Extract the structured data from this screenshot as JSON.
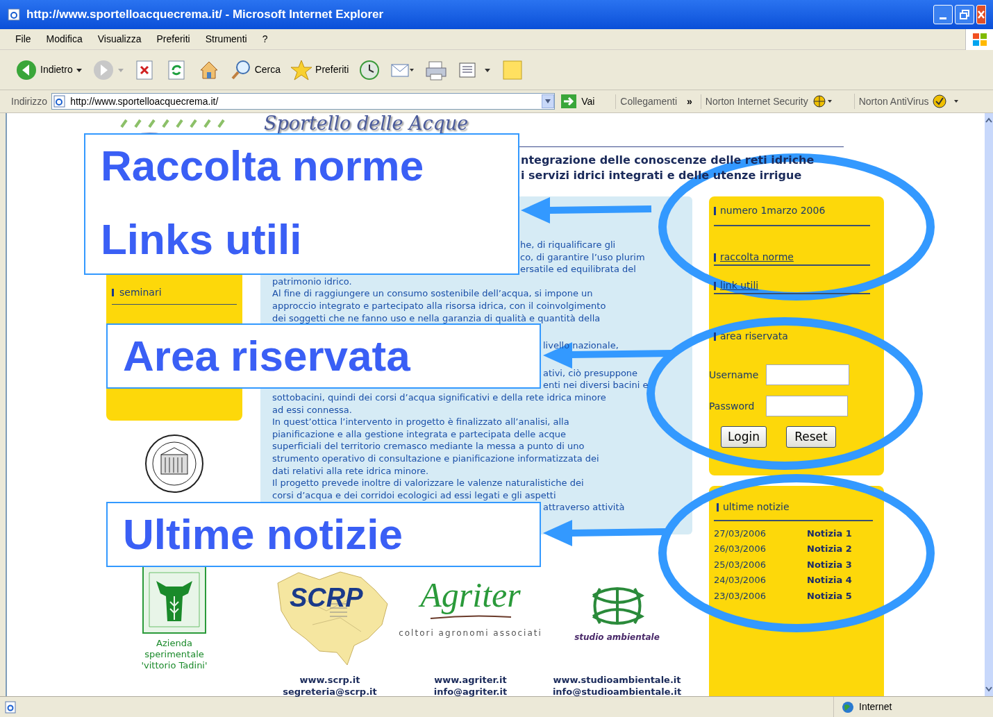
{
  "window": {
    "title": "http://www.sportelloacquecrema.it/ - Microsoft Internet Explorer"
  },
  "menu": [
    "File",
    "Modifica",
    "Visualizza",
    "Preferiti",
    "Strumenti",
    "?"
  ],
  "toolbar": [
    {
      "kind": "back",
      "label": "Indietro"
    },
    {
      "kind": "forward"
    },
    {
      "kind": "stop"
    },
    {
      "kind": "refresh"
    },
    {
      "kind": "home"
    },
    {
      "kind": "search",
      "label": "Cerca"
    },
    {
      "kind": "favorites",
      "label": "Preferiti"
    },
    {
      "kind": "history"
    },
    {
      "kind": "mail"
    },
    {
      "kind": "print"
    },
    {
      "kind": "edit"
    },
    {
      "kind": "note"
    }
  ],
  "address_bar": {
    "label": "Indirizzo",
    "url": "http://www.sportelloacquecrema.it/",
    "go": "Vai",
    "links": "Collegamenti",
    "chevron": "»",
    "norton_internet_security": "Norton Internet Security",
    "norton_antivirus": "Norton AntiVirus"
  },
  "page": {
    "logo_title": "Sportello delle Acque",
    "subtitle": [
      "ntegrazione delle conoscenze delle reti idriche",
      "i servizi idrici integrati e delle utenze irrigue"
    ],
    "left_menu": [
      {
        "label": "seminari"
      }
    ],
    "body_lines": [
      {
        "text": "he, di riqualificare gli",
        "kind": "after_top_note",
        "gap_before": false
      },
      {
        "text": "co, di garantire l’uso plurim",
        "kind": "after_top_note",
        "gap_before": false
      },
      {
        "text": "ersatile ed equilibrata del",
        "kind": "after_top_note",
        "gap_before": false
      },
      {
        "text": "patrimonio idrico.",
        "kind": "full",
        "gap_before": false
      },
      {
        "text": "Al fine di raggiungere un consumo sostenibile dell’acqua, si impone un",
        "kind": "full",
        "gap_before": false
      },
      {
        "text": "approccio integrato e partecipato alla risorsa idrica, con il coinvolgimento",
        "kind": "full",
        "gap_before": false
      },
      {
        "text": "dei soggetti che ne fanno uso e nella garanzia di qualità e quantità della",
        "kind": "full",
        "gap_before": false
      },
      {
        "text": "livello nazionale,",
        "kind": "after_mid_note",
        "gap_before": true
      },
      {
        "text": "ativi, ciò presuppone",
        "kind": "after_mid_note",
        "gap_before": true
      },
      {
        "text": "enti nei diversi bacini e",
        "kind": "after_mid_note",
        "gap_before": false
      },
      {
        "text": "sottobacini, quindi dei corsi d’acqua significativi e della rete idrica minore",
        "kind": "full",
        "gap_before": false
      },
      {
        "text": "ad essi connessa.",
        "kind": "full",
        "gap_before": false
      },
      {
        "text": "In quest’ottica l’intervento in progetto è finalizzato all’analisi, alla",
        "kind": "full",
        "gap_before": false
      },
      {
        "text": "pianificazione e alla gestione integrata e partecipata delle acque",
        "kind": "full",
        "gap_before": false
      },
      {
        "text": "superficiali del territorio cremasco mediante la messa a punto di uno",
        "kind": "full",
        "gap_before": false
      },
      {
        "text": "strumento operativo di consultazione e pianificazione informatizzata dei",
        "kind": "full",
        "gap_before": false
      },
      {
        "text": "dati relativi alla rete idrica minore.",
        "kind": "full",
        "gap_before": false
      },
      {
        "text": "Il progetto prevede inoltre di valorizzare le valenze naturalistiche dei",
        "kind": "full",
        "gap_before": false
      },
      {
        "text": "corsi d’acqua e dei corridoi ecologici ad essi legati e gli aspetti",
        "kind": "full",
        "gap_before": false
      },
      {
        "text": "attraverso attività",
        "kind": "after_mid_note",
        "gap_before": false
      }
    ],
    "side_menu": [
      {
        "label": "numero 1marzo 2006",
        "kind": "issue"
      },
      {
        "label": "raccolta norme",
        "kind": "link"
      },
      {
        "label": "link utili",
        "kind": "link"
      },
      {
        "label": "area riservata",
        "kind": "section"
      }
    ],
    "login": {
      "username_label": "Username",
      "password_label": "Password",
      "login_button": "Login",
      "reset_button": "Reset"
    },
    "news": {
      "heading": "ultime notizie",
      "items": [
        {
          "date": "27/03/2006",
          "title": "Notizia 1"
        },
        {
          "date": "26/03/2006",
          "title": "Notizia 2"
        },
        {
          "date": "25/03/2006",
          "title": "Notizia 3"
        },
        {
          "date": "24/03/2006",
          "title": "Notizia 4"
        },
        {
          "date": "23/03/2006",
          "title": "Notizia 5"
        }
      ]
    },
    "partners": [
      {
        "kind": "azienda",
        "caption": [
          "Azienda",
          "sperimentale",
          "'vittorio Tadini'"
        ]
      },
      {
        "kind": "scrp",
        "logo_text": "SCRP",
        "links": [
          "www.scrp.it",
          "segreteria@scrp.it"
        ]
      },
      {
        "kind": "agriter",
        "logo_text": "Agriter",
        "tagline": "coltori agronomi associati",
        "links": [
          "www.agriter.it",
          "info@agriter.it"
        ]
      },
      {
        "kind": "studio",
        "tagline": "studio ambientale",
        "links": [
          "www.studioambientale.it",
          "info@studioambientale.it"
        ]
      }
    ]
  },
  "annotations": [
    {
      "lines": [
        "Raccolta norme",
        "Links utili"
      ]
    },
    {
      "lines": [
        "Area riservata"
      ]
    },
    {
      "lines": [
        "Ultime notizie"
      ]
    }
  ],
  "status_bar": {
    "zone": "Internet"
  }
}
